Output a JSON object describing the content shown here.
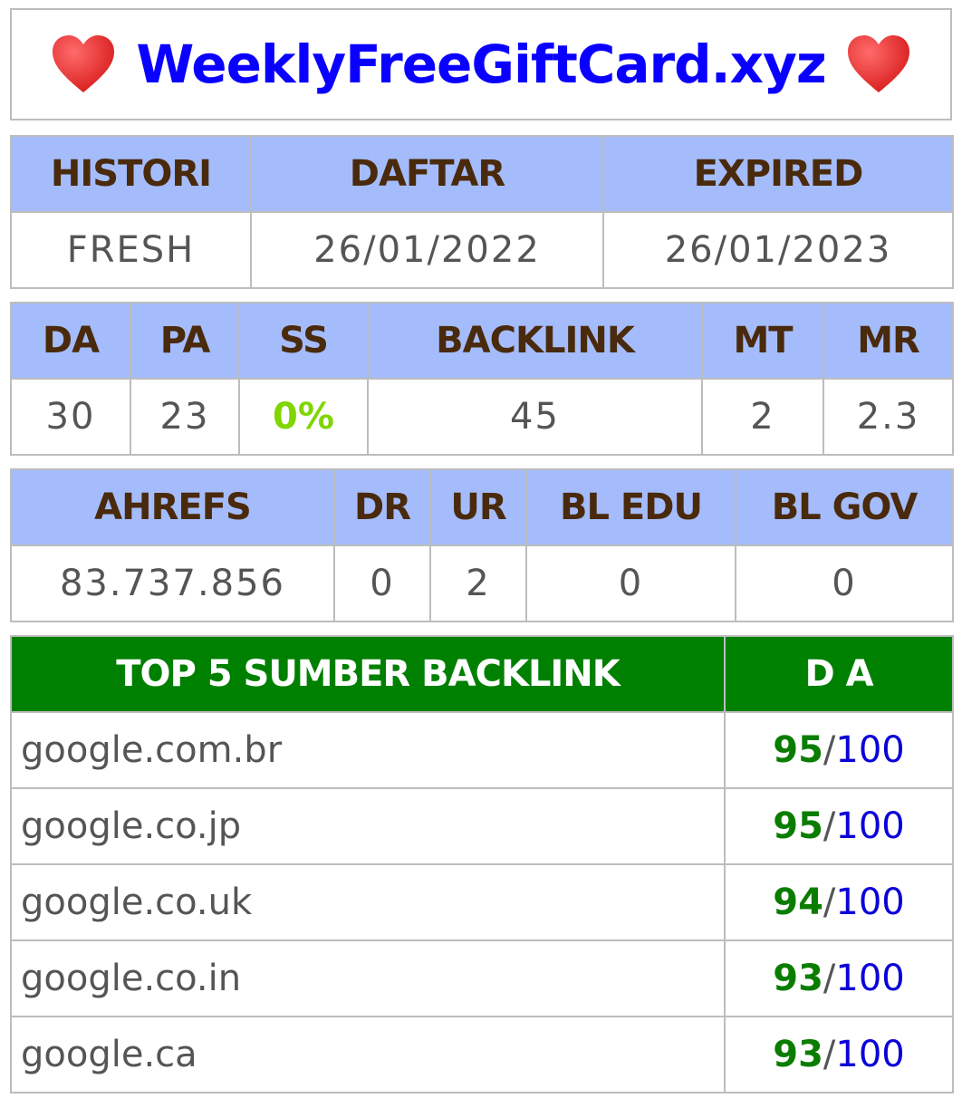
{
  "title": "WeeklyFreeGiftCard.xyz",
  "icons": {
    "left": "heart-icon",
    "right": "heart-icon"
  },
  "colors": {
    "title": "#0a00ff",
    "header_bg": "#a4bcfb",
    "top5_header_bg": "#008000",
    "ss_value": "#7fd600",
    "da_score": "#0a7d00",
    "da_max": "#0a00d8"
  },
  "info_table": {
    "headers": [
      "HISTORI",
      "DAFTAR",
      "EXPIRED"
    ],
    "values": [
      "FRESH",
      "26/01/2022",
      "26/01/2023"
    ]
  },
  "metrics_table": {
    "headers": [
      "DA",
      "PA",
      "SS",
      "BACKLINK",
      "MT",
      "MR"
    ],
    "values": [
      "30",
      "23",
      "0%",
      "45",
      "2",
      "2.3"
    ]
  },
  "ahrefs_table": {
    "headers": [
      "AHREFS",
      "DR",
      "UR",
      "BL EDU",
      "BL GOV"
    ],
    "values": [
      "83.737.856",
      "0",
      "2",
      "0",
      "0"
    ]
  },
  "top5_table": {
    "headers": [
      "TOP 5 SUMBER BACKLINK",
      "D A"
    ],
    "rows": [
      {
        "domain": "google.com.br",
        "score": "95",
        "sep": "/",
        "max": "100"
      },
      {
        "domain": "google.co.jp",
        "score": "95",
        "sep": "/",
        "max": "100"
      },
      {
        "domain": "google.co.uk",
        "score": "94",
        "sep": "/",
        "max": "100"
      },
      {
        "domain": "google.co.in",
        "score": "93",
        "sep": "/",
        "max": "100"
      },
      {
        "domain": "google.ca",
        "score": "93",
        "sep": "/",
        "max": "100"
      }
    ]
  }
}
